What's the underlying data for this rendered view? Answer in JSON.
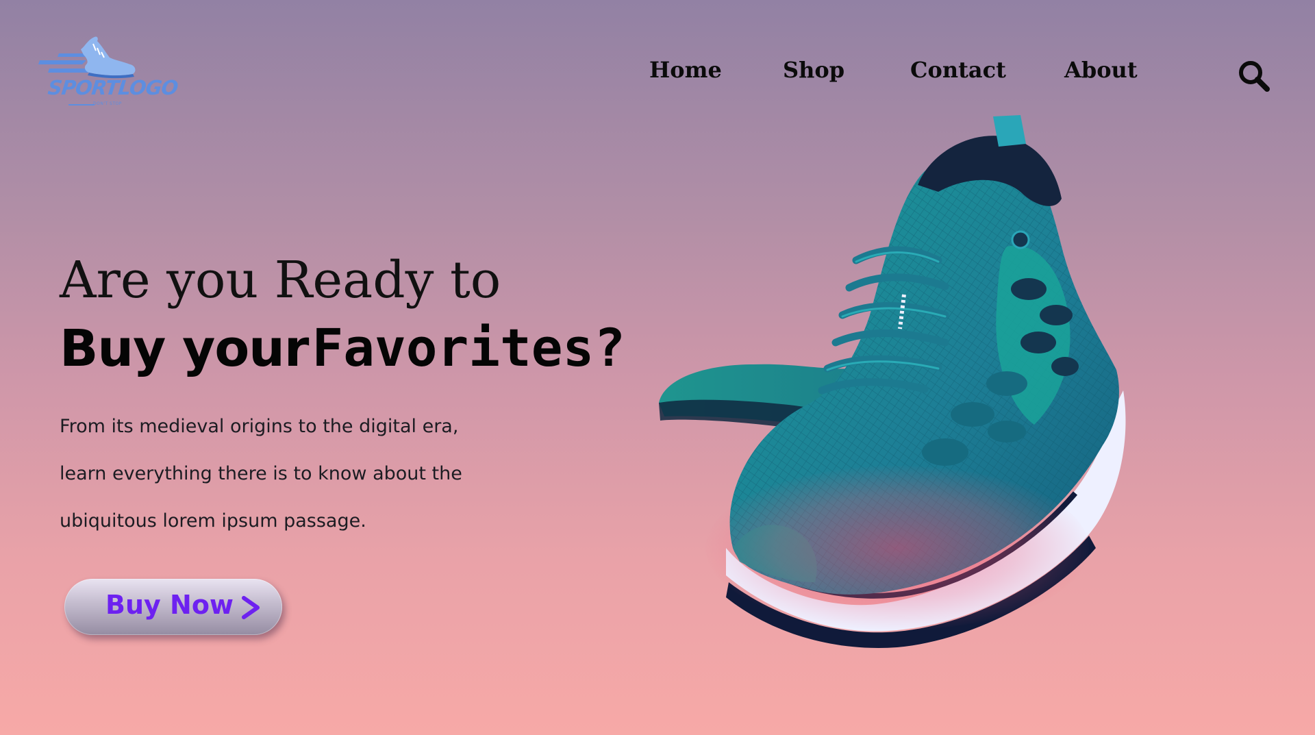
{
  "brand": {
    "logo_word": "SPORTLOGO",
    "logo_tagline": "DON'T STOP",
    "logo_color": "#5d8ee0"
  },
  "nav": {
    "items": [
      {
        "label": "Home"
      },
      {
        "label": "Shop"
      },
      {
        "label": "Contact"
      },
      {
        "label": "About"
      }
    ],
    "search_icon": "search-icon"
  },
  "hero": {
    "line1": "Are you Ready to",
    "line2_part1": "Buy your",
    "line2_part2": "Favorites?",
    "description": [
      "From its medieval origins to the digital era,",
      "learn everything there is to know about the",
      "ubiquitous lorem ipsum passage."
    ],
    "cta_label": "Buy Now",
    "cta_icon": "chevron-right-icon",
    "cta_color": "#6d21f0"
  },
  "image": {
    "subject": "teal running shoes pair",
    "colors": {
      "upper": "#1f8f98",
      "sole": "#eef0ff",
      "shadow": "#f0466e"
    }
  }
}
